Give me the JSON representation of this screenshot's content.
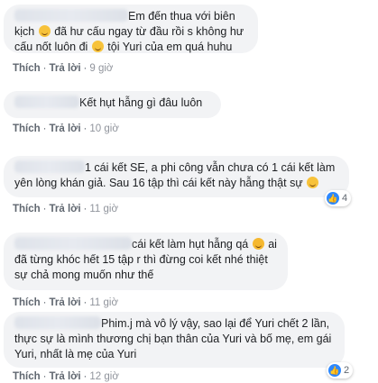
{
  "comments": [
    {
      "text": "Em đến thua với biên kịch",
      "text2": "đã hư cấu ngay từ đầu rồi s không hư cấu nốt luôn đi",
      "text3": "tội Yuri của em quá huhu",
      "like": "Thích",
      "reply": "Trả lời",
      "time": "9 giờ"
    },
    {
      "text": "Kết hụt hẫng gì đâu luôn",
      "like": "Thích",
      "reply": "Trả lời",
      "time": "10 giờ"
    },
    {
      "text": "1 cái kết SE, a phi công vẫn chưa có 1 cái kết làm yên lòng khán giả. Sau 16 tập thì cái kết này hẫng thật sự",
      "like": "Thích",
      "reply": "Trả lời",
      "time": "11 giờ",
      "reaction_count": "4"
    },
    {
      "text": "cái kết làm hụt hẫng qá",
      "text2": "ai đã từng khóc hết 15 tập r thì đừng coi kết nhé thiệt sự chả mong muốn như thế",
      "like": "Thích",
      "reply": "Trả lời",
      "time": "11 giờ"
    },
    {
      "text": "Phim.j mà vô lý vậy, sao lại để Yuri chết 2 lần, thực sự là mình thương chị bạn thân của Yuri và bố mẹ, em gái Yuri, nhất là mẹ của Yuri",
      "like": "Thích",
      "reply": "Trả lời",
      "time": "12 giờ",
      "reaction_count": "2"
    }
  ],
  "separator": "·"
}
